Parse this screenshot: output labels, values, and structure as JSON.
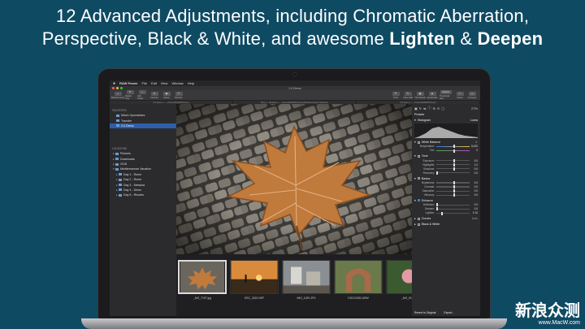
{
  "headline": {
    "line1": "12 Advanced Adjustments, including Chromatic Aberration,",
    "line2_pre": "Perspective, Black & White, and awesome ",
    "line2_b1": "Lighten",
    "line2_mid": " & ",
    "line2_b2": "Deepen"
  },
  "menubar": {
    "apple": "",
    "app": "RAW Power",
    "items": [
      "File",
      "Edit",
      "View",
      "Window",
      "Help"
    ]
  },
  "window_title": "2.0 Demo",
  "toolbar": {
    "left": [
      "Back/Forward",
      "Reflect Only",
      "Add Folder",
      "Favorite",
      "Library",
      "Browse"
    ],
    "right": [
      "Tools",
      "Inline Edit",
      "Thumbnails",
      "Quickscale",
      "Thumbnail Size",
      "Viewer",
      "Compare"
    ],
    "size_label": "Medium"
  },
  "pathbar": [
    "2.0 Demo",
    "~/Users/RAW/Pictures",
    "Day 3 - Messina",
    "~/Users/RAW/Pictures/Mediterranean Vacation",
    "2.0 Demo",
    "~/Users/RAW/Pictures"
  ],
  "sidebar": {
    "favorites_label": "FAVORITES",
    "favorites": [
      "Mira's Gymnastics",
      "Transfer",
      "2.0 Demo"
    ],
    "locations_label": "LOCATIONS",
    "locations": [
      "Pictures",
      "Downloads",
      "2018",
      "Mediterranean Vacation"
    ],
    "vacation_days": [
      "Day 1 - Rome",
      "Day 2 - Rome",
      "Day 3 - Messina",
      "Day 4 - Delos",
      "Day 5 - Rhodes"
    ]
  },
  "filmstrip": [
    {
      "caption": "_MG_7197.jpg"
    },
    {
      "caption": "DSC_3322.NEF"
    },
    {
      "caption": "IMG_1199.JPG"
    },
    {
      "caption": "DSC01352.ARW"
    },
    {
      "caption": "_MG_9133.jpg"
    }
  ],
  "inspector": {
    "zoom": "27%",
    "presets": "Presets",
    "histogram": "Histogram",
    "histogram_mode": "Luma",
    "white_balance": "White Balance",
    "wb_rows": [
      {
        "label": "Temperature:",
        "value": "5,000"
      },
      {
        "label": "Tint:",
        "value": "0"
      }
    ],
    "tone": "Tone",
    "tone_rows": [
      {
        "label": "Exposure:",
        "value": "0.0"
      },
      {
        "label": "Highlights:",
        "value": "1.0"
      },
      {
        "label": "Shadows:",
        "value": "0.0"
      },
      {
        "label": "Recovery:",
        "value": "0.0"
      }
    ],
    "basics": "Basics",
    "basics_rows": [
      {
        "label": "Brightness:",
        "value": "0.0"
      },
      {
        "label": "Contrast:",
        "value": "0.0"
      },
      {
        "label": "Saturation:",
        "value": "0.0"
      },
      {
        "label": "Vibrancy:",
        "value": "0.0"
      }
    ],
    "enhance": "Enhance",
    "enhance_rows": [
      {
        "label": "Definition:",
        "value": "0.0"
      },
      {
        "label": "Deepen:",
        "value": "0.0"
      },
      {
        "label": "Lighten:",
        "value": "0.15"
      }
    ],
    "curves": "Curves",
    "curves_mode": "Auto",
    "bw": "Black & White",
    "revert": "Revert to Original",
    "export": "Export..."
  },
  "watermark": {
    "big": "新浪众测",
    "small": "www.MacW.com"
  },
  "colors": {
    "background": "#0f4a63",
    "selection": "#2c5fa8",
    "leaf": "#c07a3c"
  }
}
